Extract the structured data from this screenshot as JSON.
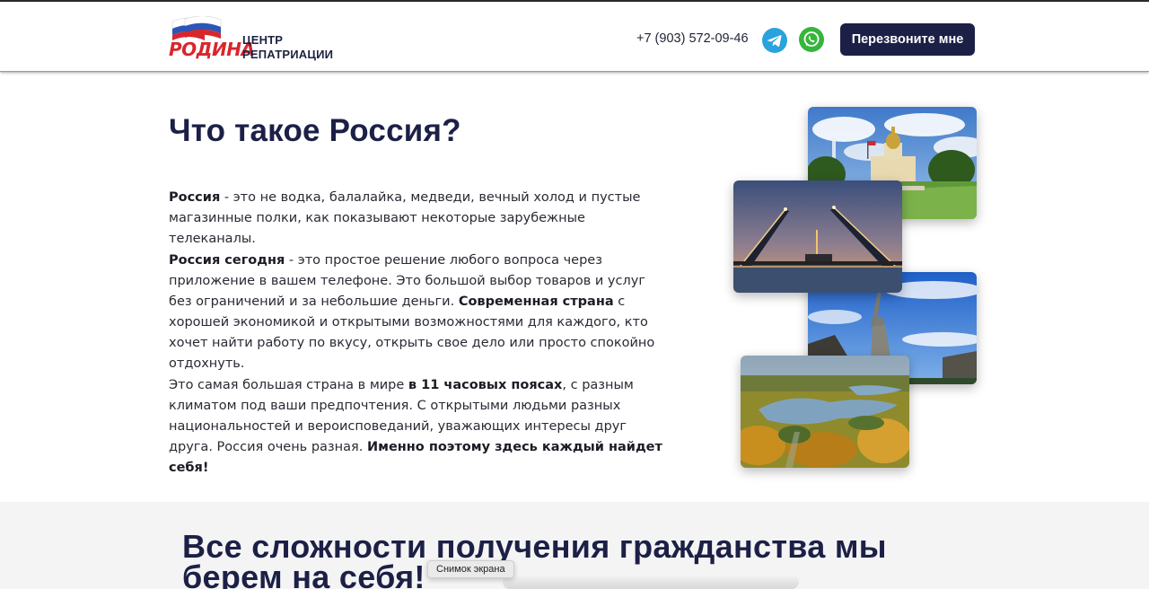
{
  "header": {
    "logo_word": "РОДИНА",
    "logo_line1": "ЦЕНТР",
    "logo_line2": "РЕПАТРИАЦИИ",
    "phone": "+7 (903) 572-09-46",
    "callback_label": "Перезвоните мне",
    "icons": [
      "telegram-icon",
      "whatsapp-icon"
    ]
  },
  "main": {
    "title": "Что такое Россия?",
    "p1_bold": "Россия",
    "p1_text": " - это не водка, балалайка, медведи, вечный холод и пустые магазинные полки, как показывают некоторые зарубежные телеканалы.",
    "p2_bold1": "Россия сегодня",
    "p2_text1": " - это простое решение любого вопроса через приложение в вашем телефоне. Это большой выбор товаров и услуг без ограничений и за небольшие деньги. ",
    "p2_bold2": "Современная страна",
    "p2_text2": " с хорошей экономикой и открытыми возможностями для каждого, кто хочет найти работу по вкусу, открыть свое дело или просто спокойно отдохнуть.",
    "p3_text1": "Это самая большая страна в мире ",
    "p3_bold1": "в 11 часовых поясах",
    "p3_text2": ", с разным климатом под ваши предпочтения. С открытыми людьми разных национальностей и вероисповеданий, уважающих интересы друг друга. Россия очень разная. ",
    "p3_bold2": "Именно поэтому здесь каждый найдет себя!"
  },
  "bottom": {
    "title": "Все сложности получения гражданства мы берем на себя!"
  },
  "tooltip": "Снимок экрана",
  "colors": {
    "brand_navy": "#1c2046",
    "brand_red": "#d8262c",
    "telegram": "#2aa3dc",
    "whatsapp": "#36b53c",
    "section_bg": "#f4f4f5"
  }
}
